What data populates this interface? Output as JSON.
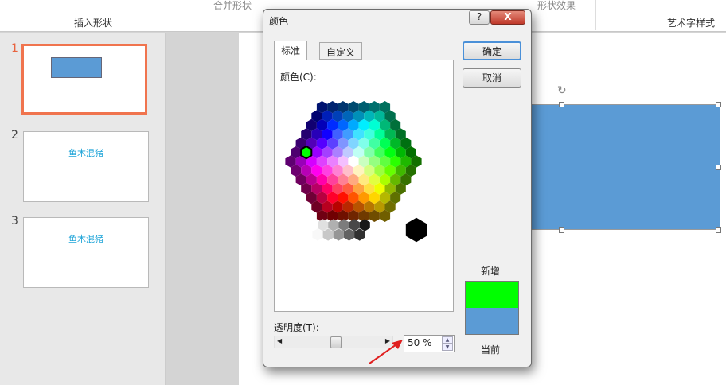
{
  "ribbon": {
    "merge_shapes": "合并形状",
    "shape_effects": "形状效果",
    "insert_shapes": "插入形状",
    "wordart_styles": "艺术字样式"
  },
  "slides": [
    {
      "num": "1",
      "title": ""
    },
    {
      "num": "2",
      "title": "鱼木混猪"
    },
    {
      "num": "3",
      "title": "鱼木混猪"
    }
  ],
  "dialog": {
    "title": "颜色",
    "help": "?",
    "close": "X",
    "tabs": [
      "标准",
      "自定义"
    ],
    "colors_label": "颜色(C):",
    "ok": "确定",
    "cancel": "取消",
    "new_label": "新增",
    "current_label": "当前",
    "transparency_label": "透明度(T):",
    "transparency_value": "50 %",
    "transparency_percent": 50,
    "new_color": "#00ff00",
    "current_color": "#5b9bd5"
  },
  "accent": {
    "shape_fill": "#5b9bd5",
    "selected_border": "#f0744e"
  }
}
